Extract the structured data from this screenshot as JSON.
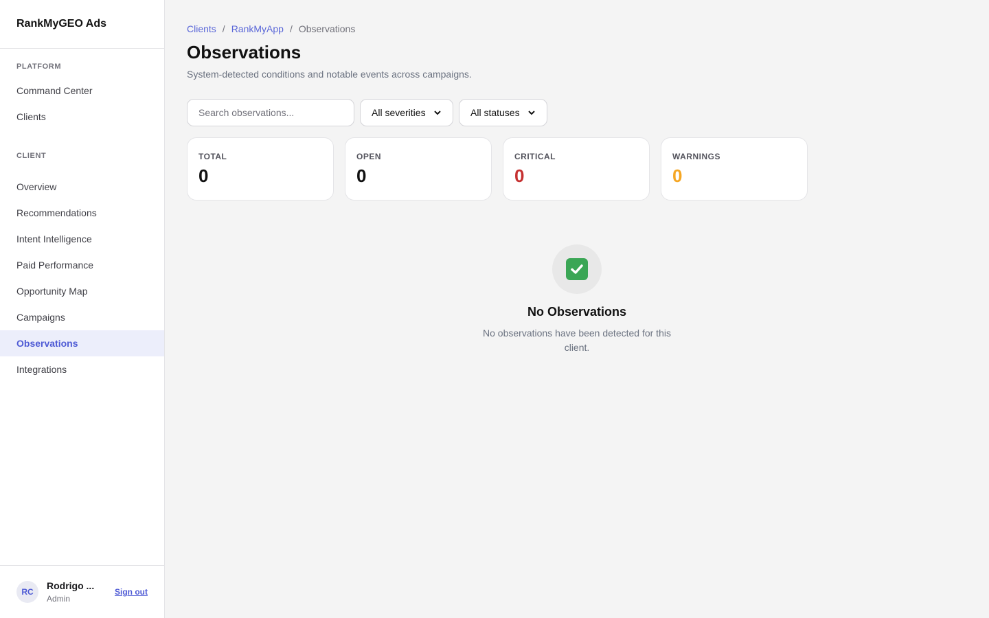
{
  "brand": {
    "name": "RankMyGEO Ads"
  },
  "sidebar": {
    "platform": {
      "title": "PLATFORM",
      "items": [
        {
          "label": "Command Center"
        },
        {
          "label": "Clients"
        }
      ]
    },
    "client": {
      "title": "CLIENT",
      "items": [
        {
          "label": "Overview"
        },
        {
          "label": "Recommendations"
        },
        {
          "label": "Intent Intelligence"
        },
        {
          "label": "Paid Performance"
        },
        {
          "label": "Opportunity Map"
        },
        {
          "label": "Campaigns"
        },
        {
          "label": "Observations"
        },
        {
          "label": "Integrations"
        }
      ],
      "active": "Observations"
    }
  },
  "user": {
    "initials": "RC",
    "name": "Rodrigo ...",
    "role": "Admin",
    "signout_label": "Sign out"
  },
  "breadcrumb": {
    "items": [
      "Clients",
      "RankMyApp",
      "Observations"
    ],
    "separator": "/"
  },
  "page": {
    "title": "Observations",
    "subtitle": "System-detected conditions and notable events across campaigns."
  },
  "filters": {
    "search_placeholder": "Search observations...",
    "severity_value": "All severities",
    "status_value": "All statuses"
  },
  "stats": {
    "total": {
      "label": "TOTAL",
      "value": "0"
    },
    "open": {
      "label": "OPEN",
      "value": "0"
    },
    "critical": {
      "label": "CRITICAL",
      "value": "0"
    },
    "warnings": {
      "label": "WARNINGS",
      "value": "0"
    }
  },
  "empty_state": {
    "icon": "check-mark-icon",
    "title": "No Observations",
    "text": "No observations have been detected for this client."
  },
  "colors": {
    "accent": "#4f5bd5",
    "critical": "#c53030",
    "warning": "#f5a623",
    "success": "#3aa655"
  }
}
